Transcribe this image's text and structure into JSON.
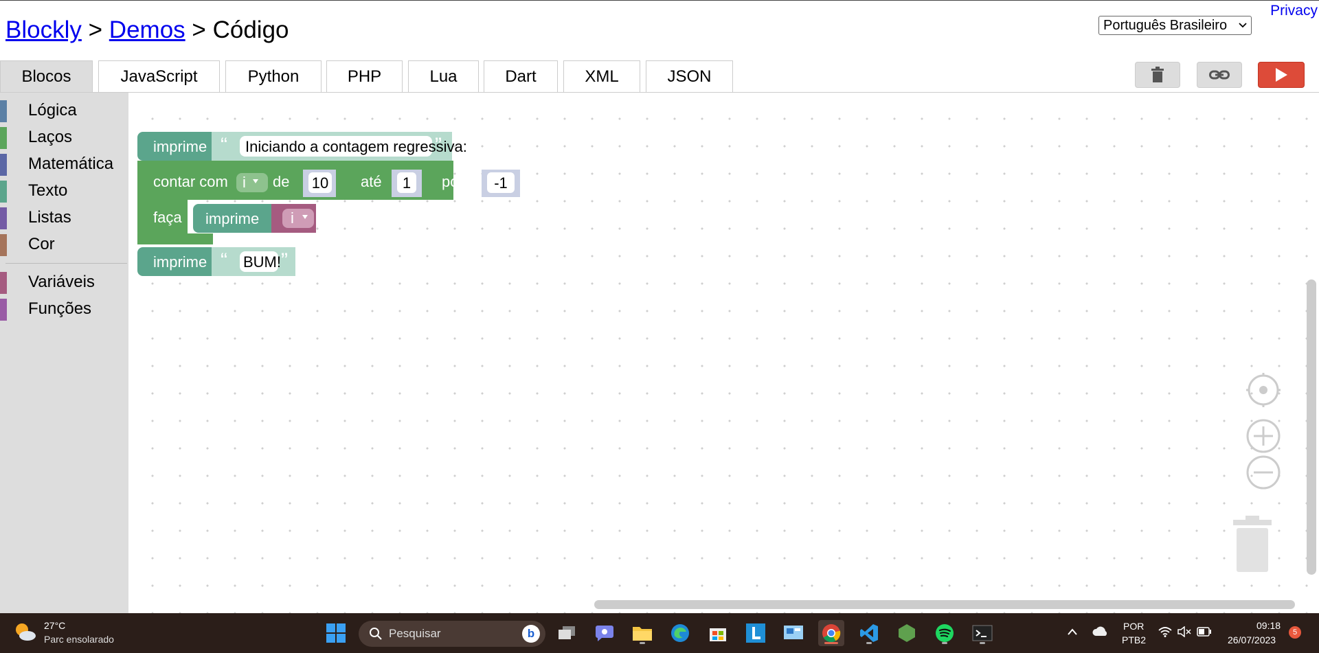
{
  "breadcrumb": {
    "link1": "Blockly",
    "link2": "Demos",
    "current": "Código",
    "sep": ">"
  },
  "privacy_label": "Privacy",
  "language": {
    "selected": "Português Brasileiro"
  },
  "tabs": [
    {
      "label": "Blocos",
      "active": true
    },
    {
      "label": "JavaScript"
    },
    {
      "label": "Python"
    },
    {
      "label": "PHP"
    },
    {
      "label": "Lua"
    },
    {
      "label": "Dart"
    },
    {
      "label": "XML"
    },
    {
      "label": "JSON"
    }
  ],
  "toolbar": {
    "trash": "trash-icon",
    "link": "link-icon",
    "run": "play-icon",
    "run_color": "#dd4b39"
  },
  "toolbox": {
    "categories": [
      {
        "label": "Lógica",
        "color": "#5b80a5"
      },
      {
        "label": "Laços",
        "color": "#5ba55b"
      },
      {
        "label": "Matemática",
        "color": "#5b67a5"
      },
      {
        "label": "Texto",
        "color": "#5ba58c"
      },
      {
        "label": "Listas",
        "color": "#745ba5"
      },
      {
        "label": "Cor",
        "color": "#a5745b"
      },
      {
        "label": "Variáveis",
        "color": "#a55b80"
      },
      {
        "label": "Funções",
        "color": "#995ba5"
      }
    ]
  },
  "blocks": {
    "print1": {
      "label": "imprime",
      "text": "Iniciando a contagem regressiva:"
    },
    "loop": {
      "label_count": "contar com",
      "var": "i",
      "label_from": "de",
      "from": "10",
      "label_to": "até",
      "to": "1",
      "label_by": "por",
      "by": "-1",
      "label_do": "faça"
    },
    "inner_print": {
      "label": "imprime",
      "var": "i"
    },
    "print2": {
      "label": "imprime",
      "text": "BUM!"
    },
    "colors": {
      "text": "#5ba58c",
      "loop": "#5ba55b",
      "variable": "#a55b80"
    }
  },
  "workspace_controls": [
    "recenter-icon",
    "zoom-in-icon",
    "zoom-out-icon",
    "trash-can-icon"
  ],
  "taskbar": {
    "weather": {
      "temp": "27°C",
      "desc": "Parc ensolarado"
    },
    "search_placeholder": "Pesquisar",
    "apps": [
      "windows-start-icon",
      "task-view-icon",
      "teams-icon",
      "file-explorer-icon",
      "edge-icon",
      "store-icon",
      "l-app-icon",
      "control-panel-icon",
      "chrome-icon",
      "vscode-icon",
      "nodejs-icon",
      "spotify-icon",
      "terminal-icon"
    ],
    "tray": {
      "lang_line1": "POR",
      "lang_line2": "PTB2",
      "time": "09:18",
      "date": "26/07/2023",
      "notifications": "5"
    }
  }
}
